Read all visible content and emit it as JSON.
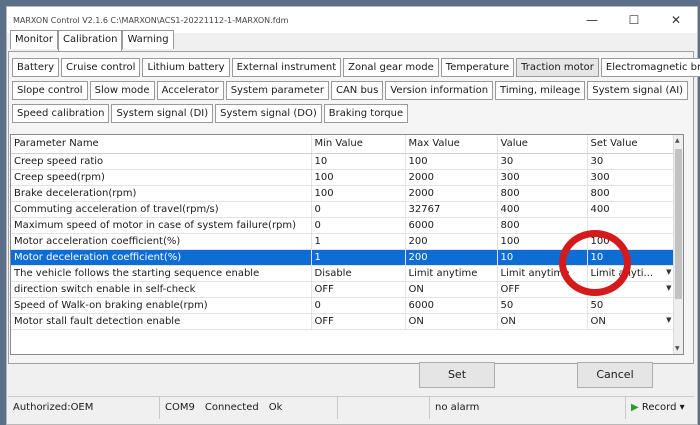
{
  "window": {
    "title": "MARXON Control V2.1.6 C:\\MARXON\\ACS1-20221112-1-MARXON.fdm",
    "min_label": "—",
    "max_label": "☐",
    "close_label": "✕"
  },
  "main_tabs": [
    "Monitor",
    "Calibration",
    "Warning"
  ],
  "sub_tabs": {
    "row1": [
      "Battery",
      "Cruise control",
      "Lithium battery",
      "External instrument",
      "Zonal gear mode",
      "Temperature",
      "Traction motor",
      "Electromagnetic brake"
    ],
    "row2": [
      "Slope control",
      "Slow mode",
      "Accelerator",
      "System parameter",
      "CAN bus",
      "Version information",
      "Timing, mileage",
      "System signal (AI)"
    ],
    "row3": [
      "Speed calibration",
      "System signal (DI)",
      "System signal (DO)",
      "Braking torque"
    ]
  },
  "table": {
    "headers": [
      "Parameter Name",
      "Min Value",
      "Max Value",
      "Value",
      "Set Value"
    ],
    "rows": [
      [
        "Creep speed ratio",
        "10",
        "100",
        "30",
        "30"
      ],
      [
        "Creep speed(rpm)",
        "100",
        "2000",
        "300",
        "300"
      ],
      [
        "Brake deceleration(rpm)",
        "100",
        "2000",
        "800",
        "800"
      ],
      [
        "Commuting acceleration of travel(rpm/s)",
        "0",
        "32767",
        "400",
        "400"
      ],
      [
        "Maximum speed of motor in case of system failure(rpm)",
        "0",
        "6000",
        "800",
        ""
      ],
      [
        "Motor acceleration coefficient(%)",
        "1",
        "200",
        "100",
        "100"
      ],
      [
        "Motor deceleration coefficient(%)",
        "1",
        "200",
        "10",
        "10"
      ],
      [
        "The vehicle follows the starting sequence enable",
        "Disable",
        "Limit anytime",
        "Limit anytime",
        "Limit anyti..."
      ],
      [
        "direction switch enable in self-check",
        "OFF",
        "ON",
        "OFF",
        ""
      ],
      [
        "Speed of Walk-on braking enable(rpm)",
        "0",
        "6000",
        "50",
        "50"
      ],
      [
        "Motor stall fault detection enable",
        "OFF",
        "ON",
        "ON",
        "ON"
      ]
    ]
  },
  "buttons": {
    "set": "Set",
    "cancel": "Cancel"
  },
  "status": {
    "auth": "Authorized:OEM",
    "port": "COM9",
    "connection": "Connected",
    "ok": "Ok",
    "alarm": "no alarm",
    "record": "Record"
  },
  "colors": {
    "selection": "#0d6dd4",
    "annotation": "#d41a1a"
  }
}
